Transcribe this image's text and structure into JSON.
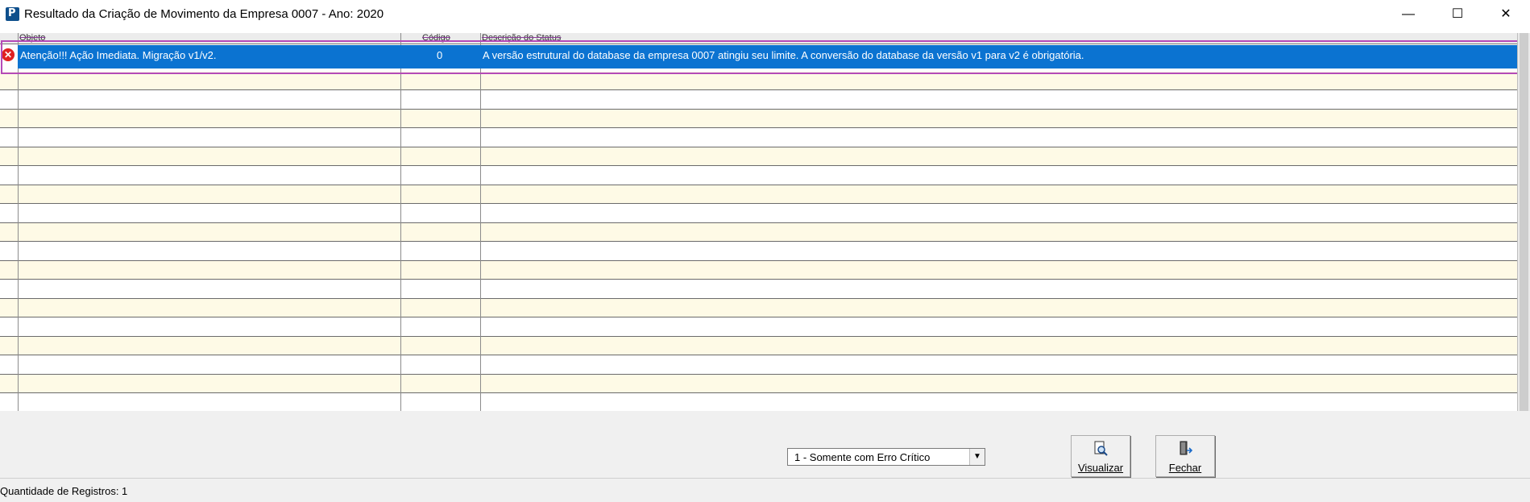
{
  "window": {
    "title": "Resultado da Criação de Movimento da Empresa 0007 - Ano: 2020",
    "app_icon_letter": "P",
    "minimize": "—",
    "maximize": "☐",
    "close": "✕"
  },
  "grid": {
    "columns": [
      "Objeto",
      "Código",
      "Descrição do Status"
    ],
    "rows": [
      {
        "status_icon": "error-icon",
        "objeto": "Atenção!!! Ação Imediata. Migração v1/v2.",
        "codigo": "0",
        "descricao": "A versão estrutural do database da empresa 0007 atingiu seu limite. A conversão do database da versão v1 para v2 é obrigatória."
      }
    ],
    "empty_row_count": 18
  },
  "filter": {
    "selected": "1 - Somente com Erro Crítico"
  },
  "buttons": {
    "visualizar": "Visualizar",
    "fechar": "Fechar"
  },
  "status": {
    "count_text": "Quantidade de Registros: 1"
  },
  "colors": {
    "selection": "#0b73d1",
    "alt_row": "#fefae6",
    "error": "#e02020"
  }
}
